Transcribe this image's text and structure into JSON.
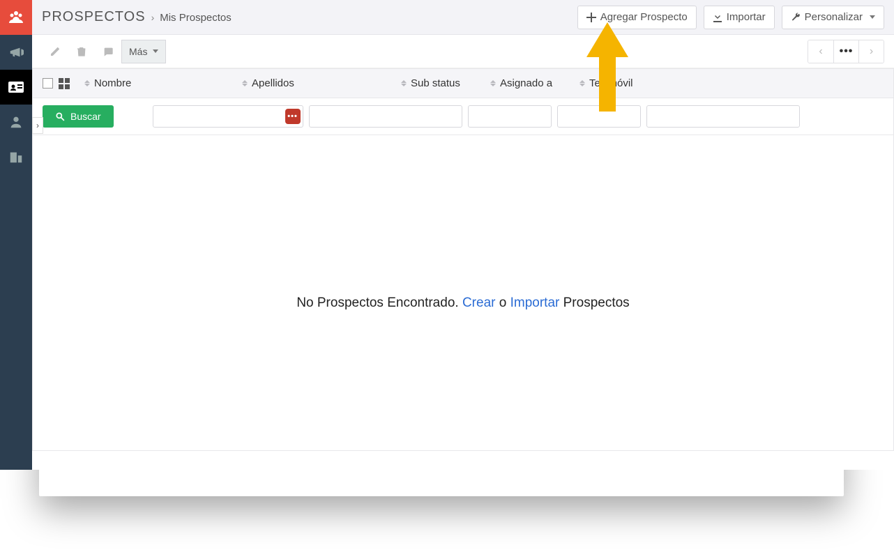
{
  "sidebar": {
    "items": [
      {
        "name": "people-icon"
      },
      {
        "name": "megaphone-icon"
      },
      {
        "name": "id-card-icon"
      },
      {
        "name": "user-icon"
      },
      {
        "name": "building-icon"
      }
    ]
  },
  "breadcrumb": {
    "title": "PROSPECTOS",
    "separator": "›",
    "current": "Mis Prospectos"
  },
  "header_buttons": {
    "add": "Agregar Prospecto",
    "import": "Importar",
    "customize": "Personalizar"
  },
  "toolbar": {
    "more_label": "Más"
  },
  "columns": {
    "name": "Nombre",
    "lastname": "Apellidos",
    "substatus": "Sub status",
    "assigned": "Asignado a",
    "mobile": "Tel. móvil"
  },
  "search": {
    "button": "Buscar"
  },
  "filters": {
    "name_value": "",
    "lastname_value": "",
    "substatus_value": "",
    "assigned_value": "",
    "mobile_value": ""
  },
  "empty_state": {
    "prefix": "No Prospectos Encontrado. ",
    "create": "Crear",
    "or": " o ",
    "import": "Importar",
    "suffix": " Prospectos"
  }
}
